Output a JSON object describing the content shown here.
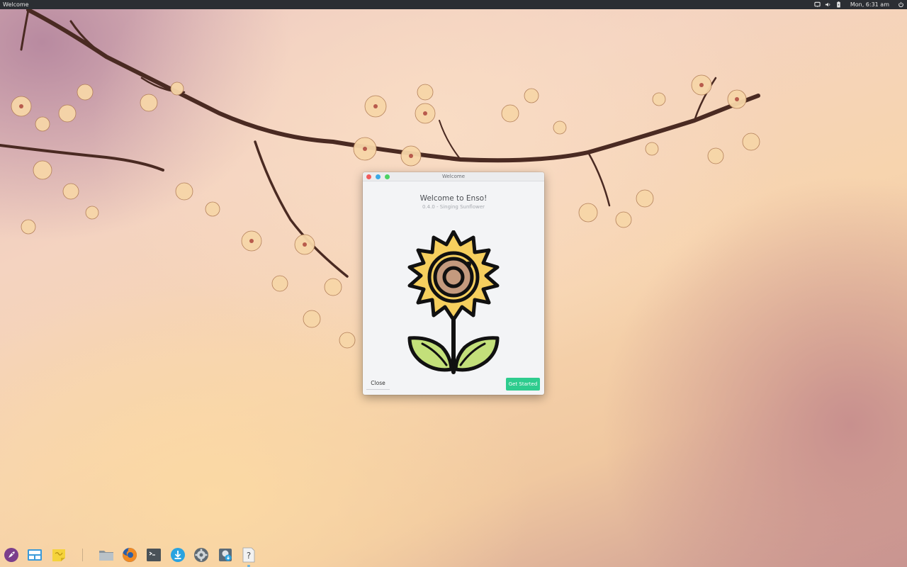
{
  "top_panel": {
    "app_name": "Welcome",
    "clock": "Mon, 6:31 am",
    "tray_icons": [
      "notification-icon",
      "volume-icon",
      "battery-icon",
      "power-icon"
    ]
  },
  "window": {
    "title": "Welcome",
    "heading": "Welcome to Enso!",
    "version": "0.4.0 - Singing Sunflower",
    "close_label": "Close",
    "get_started_label": "Get Started",
    "colors": {
      "accent": "#2ecc8e",
      "petal": "#f6cf5e",
      "center": "#c49a7e",
      "leaf": "#c3e07a"
    }
  },
  "dock": {
    "items": [
      "launcher-icon",
      "workspaces-icon",
      "sticky-notes-icon",
      "files-icon",
      "firefox-icon",
      "terminal-icon",
      "downloads-icon",
      "settings-icon",
      "software-installer-icon",
      "help-icon"
    ]
  }
}
